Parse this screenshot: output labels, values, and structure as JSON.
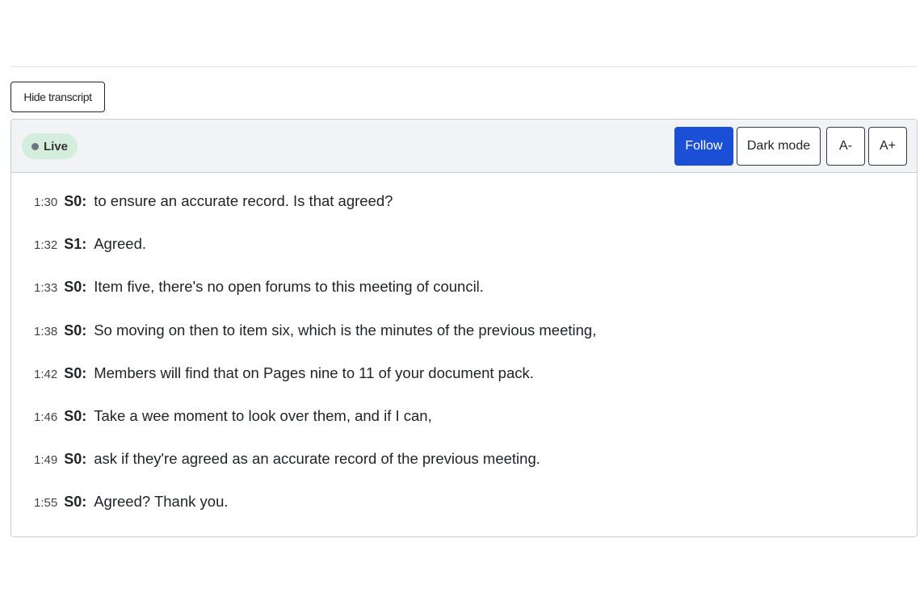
{
  "controls": {
    "hide_transcript_label": "Hide transcript"
  },
  "header": {
    "live_label": "Live",
    "follow_label": "Follow",
    "dark_mode_label": "Dark mode",
    "font_decrease_label": "A-",
    "font_increase_label": "A+"
  },
  "colors": {
    "follow_active": "#1a4fd6",
    "live_badge_bg": "#d4eddc",
    "header_bg": "#f1f3f6"
  },
  "transcript": [
    {
      "time": "1:30",
      "speaker": "S0:",
      "text": "to ensure an accurate record. Is that agreed?"
    },
    {
      "time": "1:32",
      "speaker": "S1:",
      "text": "Agreed."
    },
    {
      "time": "1:33",
      "speaker": "S0:",
      "text": "Item five, there's no open forums to this meeting of council."
    },
    {
      "time": "1:38",
      "speaker": "S0:",
      "text": "So moving on then to item six, which is the minutes of the previous meeting,"
    },
    {
      "time": "1:42",
      "speaker": "S0:",
      "text": "Members will find that on Pages nine to 11 of your document pack."
    },
    {
      "time": "1:46",
      "speaker": "S0:",
      "text": "Take a wee moment to look over them, and if I can,"
    },
    {
      "time": "1:49",
      "speaker": "S0:",
      "text": "ask if they're agreed as an accurate record of the previous meeting."
    },
    {
      "time": "1:55",
      "speaker": "S0:",
      "text": "Agreed? Thank you."
    }
  ]
}
